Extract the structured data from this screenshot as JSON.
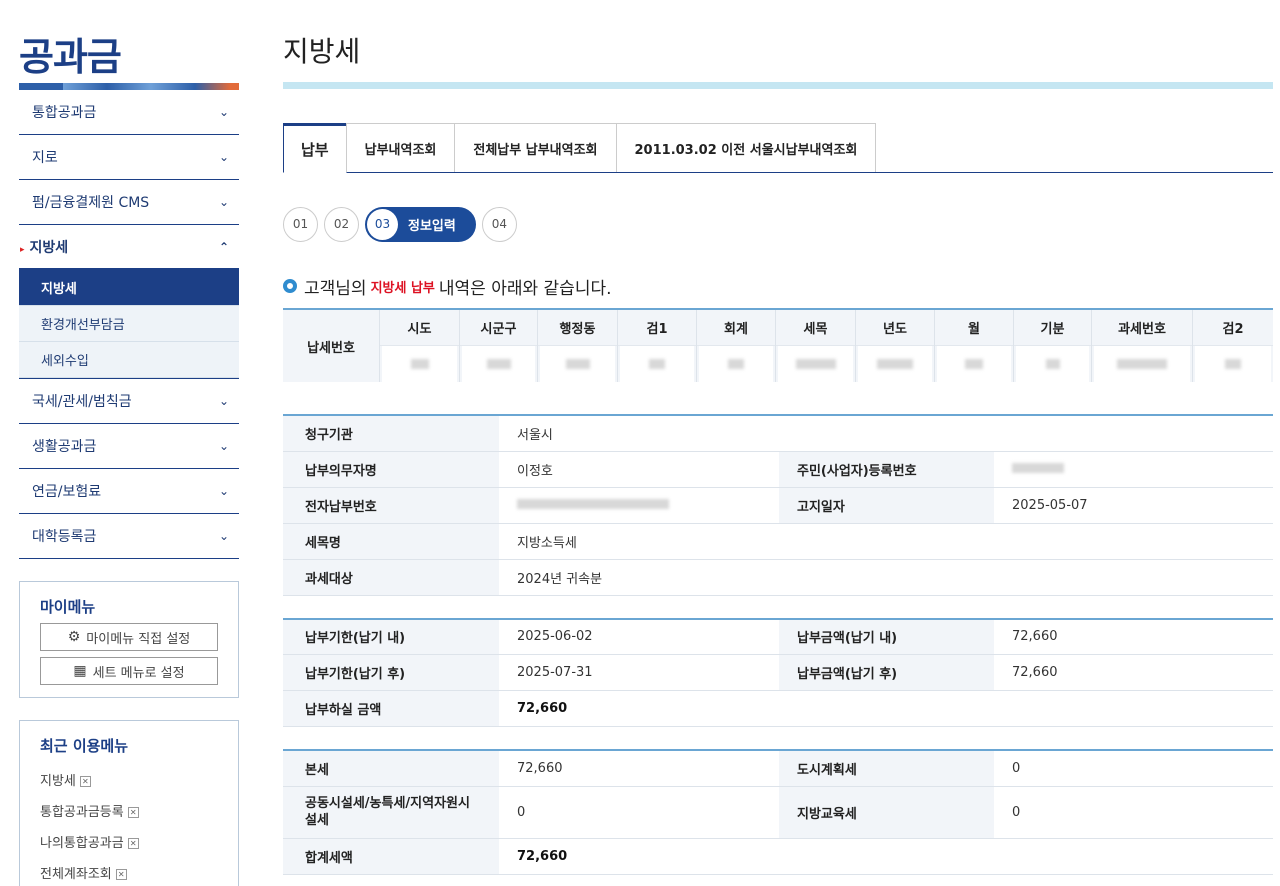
{
  "brand": "공과금",
  "sidebar": {
    "items": [
      {
        "label": "통합공과금"
      },
      {
        "label": "지로"
      },
      {
        "label": "펌/금융결제원 CMS"
      },
      {
        "label": "지방세"
      }
    ],
    "subitems": [
      {
        "label": "지방세"
      },
      {
        "label": "환경개선부담금"
      },
      {
        "label": "세외수입"
      }
    ],
    "items_after": [
      {
        "label": "국세/관세/범칙금"
      },
      {
        "label": "생활공과금"
      },
      {
        "label": "연금/보험료"
      },
      {
        "label": "대학등록금"
      }
    ],
    "mymenu": {
      "title": "마이메뉴",
      "direct_setting": "마이메뉴 직접 설정",
      "set_menu": "세트 메뉴로 설정"
    },
    "recent": {
      "title": "최근 이용메뉴",
      "items": [
        "지방세",
        "통합공과금등록",
        "나의통합공과금",
        "전체계좌조회"
      ]
    }
  },
  "main": {
    "title": "지방세",
    "tabs": [
      "납부",
      "납부내역조회",
      "전체납부 납부내역조회",
      "2011.03.02 이전 서울시납부내역조회"
    ],
    "steps": {
      "s1": "01",
      "s2": "02",
      "s3": "03",
      "s3_label": "정보입력",
      "s4": "04"
    },
    "info": {
      "prefix": "고객님의",
      "highlight": "지방세 납부",
      "suffix": "내역은 아래와 같습니다."
    },
    "taxno": {
      "label": "납세번호",
      "columns": [
        "시도",
        "시군구",
        "행정동",
        "검1",
        "회계",
        "세목",
        "년도",
        "월",
        "기분",
        "과세번호",
        "검2"
      ]
    },
    "billing": {
      "agency_label": "청구기관",
      "agency": "서울시",
      "payer_label": "납부의무자명",
      "payer": "이정호",
      "reg_label": "주민(사업자)등록번호",
      "epay_label": "전자납부번호",
      "notice_label": "고지일자",
      "notice": "2025-05-07",
      "item_label": "세목명",
      "item": "지방소득세",
      "target_label": "과세대상",
      "target": "2024년 귀속분"
    },
    "due": {
      "before_label": "납부기한(납기 내)",
      "before": "2025-06-02",
      "amt_before_label": "납부금액(납기 내)",
      "amt_before": "72,660",
      "after_label": "납부기한(납기 후)",
      "after": "2025-07-31",
      "amt_after_label": "납부금액(납기 후)",
      "amt_after": "72,660",
      "pay_label": "납부하실 금액",
      "pay": "72,660"
    },
    "detail": {
      "main_label": "본세",
      "main": "72,660",
      "urban_label": "도시계획세",
      "urban": "0",
      "facility_label": "공동시설세/농특세/지역자원시설세",
      "facility": "0",
      "edu_label": "지방교육세",
      "edu": "0",
      "total_label": "합계세액",
      "total": "72,660"
    }
  }
}
